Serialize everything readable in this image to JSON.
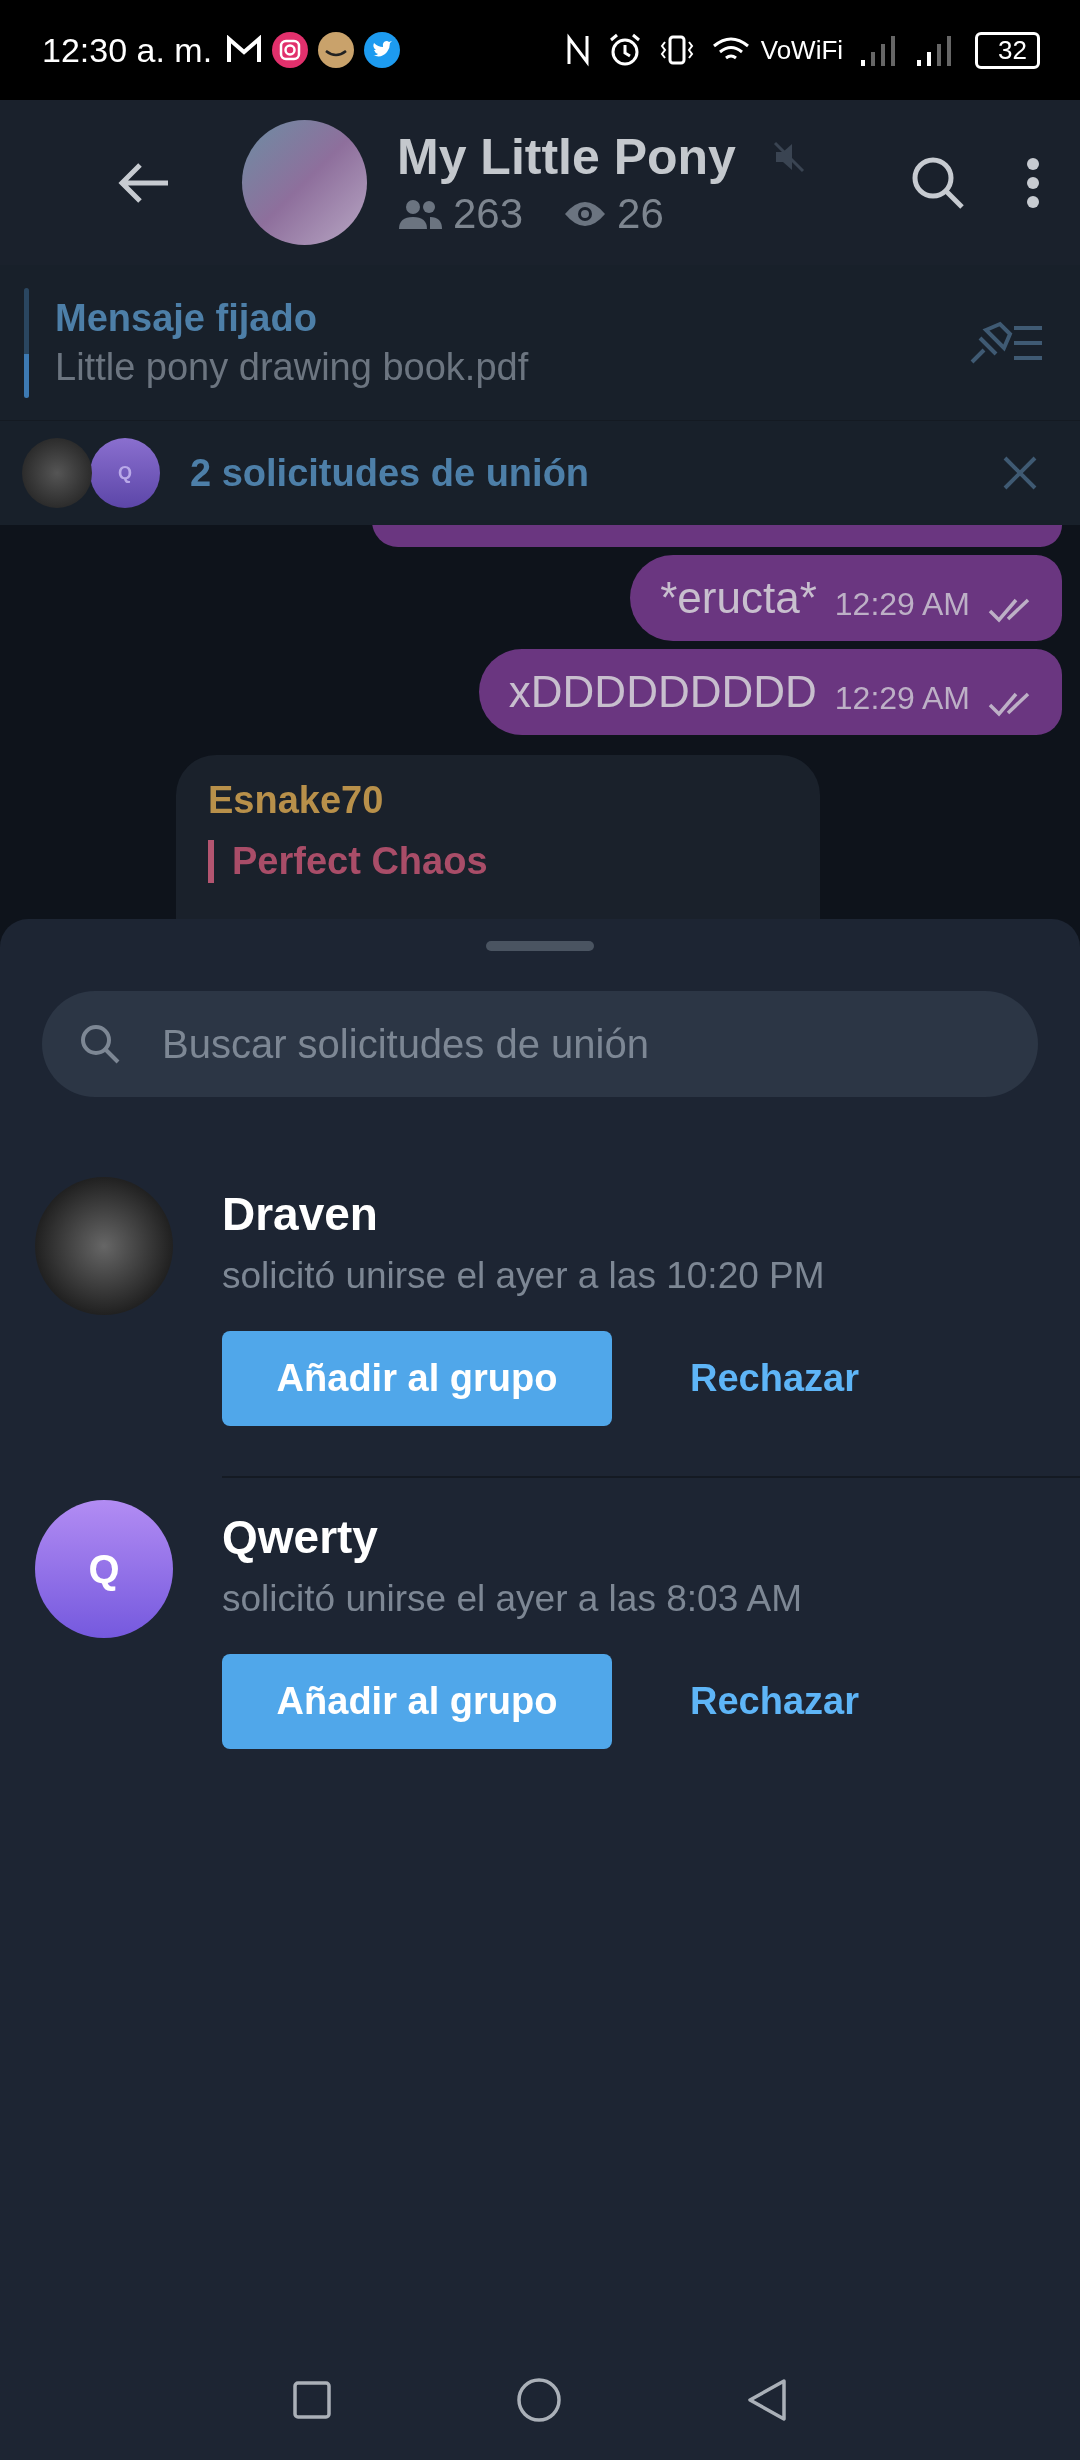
{
  "status_bar": {
    "time": "12:30 a. m.",
    "network": "VoWiFi",
    "battery": "32"
  },
  "header": {
    "title": "My Little Pony",
    "muted": true,
    "members": "263",
    "views": "26"
  },
  "pinned": {
    "label": "Mensaje fijado",
    "text": "Little pony drawing book.pdf"
  },
  "join_banner": {
    "text": "2 solicitudes de unión",
    "avatars": [
      {
        "kind": "photo"
      },
      {
        "kind": "initial",
        "initial": "Q"
      }
    ]
  },
  "messages": [
    {
      "kind": "outgoing",
      "text": "*eructa*",
      "time": "12:29 AM",
      "read": true
    },
    {
      "kind": "outgoing",
      "text": "xDDDDDDDDD",
      "time": "12:29 AM",
      "read": true
    },
    {
      "kind": "incoming",
      "sender": "Esnake70",
      "reply_title": "Perfect Chaos"
    }
  ],
  "sheet": {
    "search": {
      "placeholder": "Buscar solicitudes de unión"
    },
    "requests": [
      {
        "avatar": {
          "kind": "photo"
        },
        "name": "Draven",
        "subtitle": "solicitó unirse el ayer a las 10:20 PM",
        "add_label": "Añadir al grupo",
        "reject_label": "Rechazar"
      },
      {
        "avatar": {
          "kind": "initial",
          "initial": "Q"
        },
        "name": "Qwerty",
        "subtitle": "solicitó unirse el ayer a las 8:03 AM",
        "add_label": "Añadir al grupo",
        "reject_label": "Rechazar"
      }
    ]
  }
}
